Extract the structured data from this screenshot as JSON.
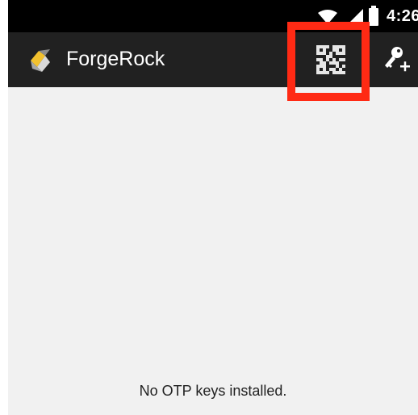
{
  "status_bar": {
    "time": "4:26",
    "icons": [
      "wifi-icon",
      "signal-icon",
      "battery-icon"
    ]
  },
  "app_bar": {
    "title": "ForgeRock",
    "logo_icon": "forgerock-logo-icon",
    "actions": [
      {
        "name": "scan-qr-code",
        "icon": "qr-code-icon",
        "highlighted": true
      },
      {
        "name": "add-key",
        "icon": "key-add-icon"
      }
    ]
  },
  "main": {
    "empty_message": "No OTP keys installed."
  },
  "colors": {
    "status_bar": "#000000",
    "app_bar": "#212121",
    "background": "#f1f1f1",
    "highlight": "#ff2a14",
    "logo_yellow": "#f2c12e"
  }
}
